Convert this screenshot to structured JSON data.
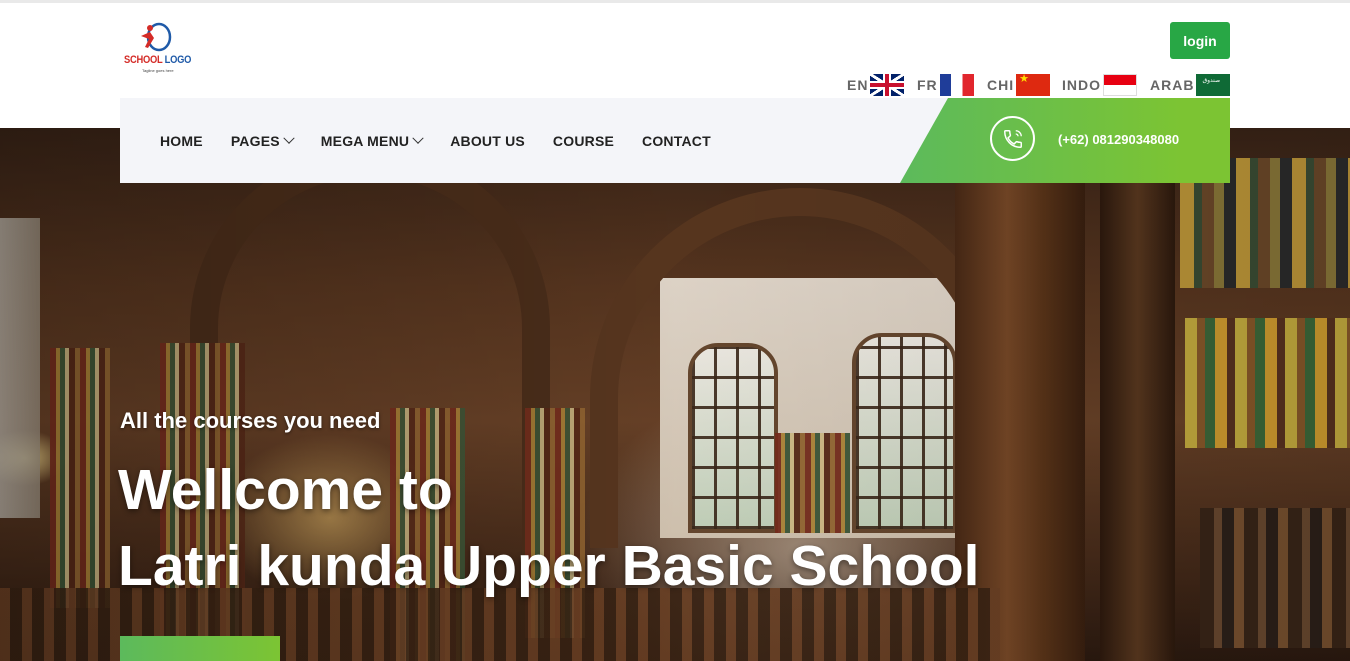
{
  "header": {
    "logo": {
      "text_main": "SCHOOL",
      "text_accent": "LOGO",
      "tagline": "Tagline goes here"
    },
    "login_label": "login",
    "languages": [
      {
        "code": "EN",
        "flag": "uk-flag-icon"
      },
      {
        "code": "FR",
        "flag": "france-flag-icon"
      },
      {
        "code": "CHI",
        "flag": "china-flag-icon"
      },
      {
        "code": "INDO",
        "flag": "indonesia-flag-icon"
      },
      {
        "code": "ARAB",
        "flag": "saudi-flag-icon"
      }
    ]
  },
  "nav": {
    "items": [
      {
        "label": "HOME",
        "has_dropdown": false
      },
      {
        "label": "PAGES",
        "has_dropdown": true
      },
      {
        "label": "MEGA MENU",
        "has_dropdown": true
      },
      {
        "label": "ABOUT US",
        "has_dropdown": false
      },
      {
        "label": "COURSE",
        "has_dropdown": false
      },
      {
        "label": "CONTACT",
        "has_dropdown": false
      }
    ],
    "phone": "(+62) 081290348080"
  },
  "hero": {
    "subtitle": "All the courses you need",
    "title_line1": "Wellcome to",
    "title_line2": "Latri kunda Upper Basic School"
  },
  "colors": {
    "accent_green": "#28a745",
    "gradient_start": "#5cba5c",
    "gradient_end": "#7cc433"
  }
}
